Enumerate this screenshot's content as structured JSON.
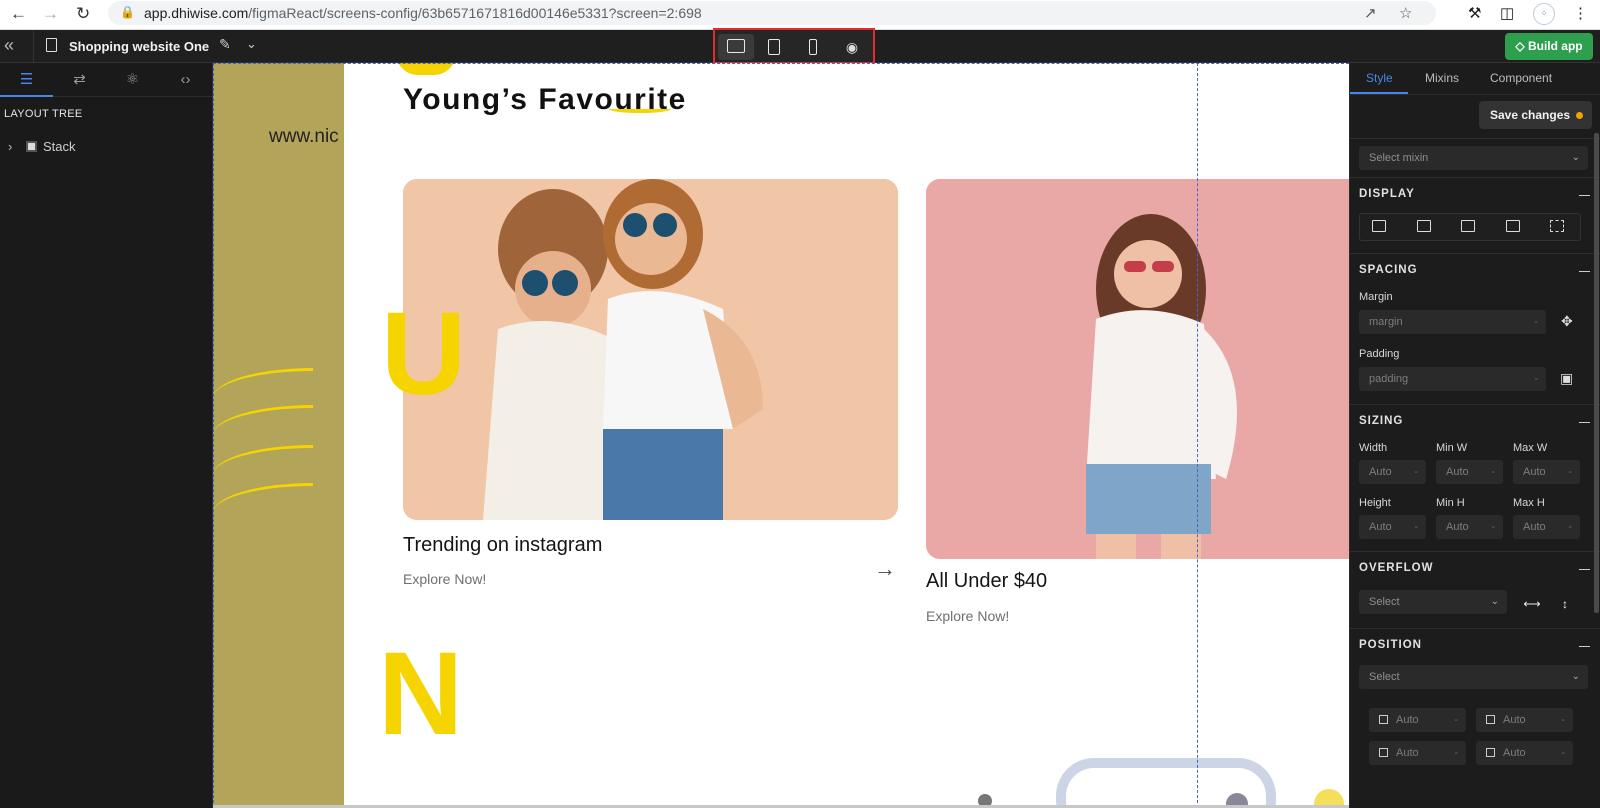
{
  "browser": {
    "url_host": "app.dhiwise.com",
    "url_path": "/figmaReact/screens-config/63b6571671816d00146e5331?screen=2:698"
  },
  "appbar": {
    "project_title": "Shopping website One",
    "build_label": "Build app"
  },
  "left_panel": {
    "layout_tree_label": "LAYOUT TREE",
    "tree_root": "Stack"
  },
  "canvas": {
    "url_fragment": "www.nic",
    "heading": "Young’s Favourite",
    "big_letter_1": "U",
    "big_letter_2": "N",
    "cards": [
      {
        "title": "Trending on instagram",
        "link": "Explore Now!"
      },
      {
        "title": "All Under $40",
        "link": "Explore Now!"
      }
    ],
    "colors": {
      "accent_yellow": "#f5d400",
      "olive": "#b2a55a"
    }
  },
  "right_panel": {
    "tabs": [
      "Style",
      "Mixins",
      "Component"
    ],
    "save_label": "Save changes",
    "mixin_placeholder": "Select mixin",
    "display_label": "DISPLAY",
    "spacing_label": "SPACING",
    "margin_label": "Margin",
    "margin_placeholder": "margin",
    "padding_label": "Padding",
    "padding_placeholder": "padding",
    "sizing_label": "SIZING",
    "width_label": "Width",
    "minw_label": "Min W",
    "maxw_label": "Max W",
    "height_label": "Height",
    "minh_label": "Min H",
    "maxh_label": "Max H",
    "auto": "Auto",
    "dash": "-",
    "overflow_label": "OVERFLOW",
    "overflow_placeholder": "Select",
    "position_label": "POSITION",
    "position_placeholder": "Select"
  }
}
